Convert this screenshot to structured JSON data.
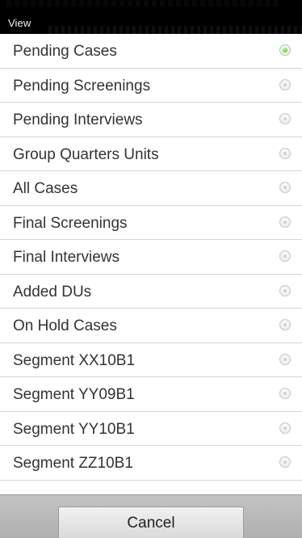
{
  "dialog": {
    "title": "View",
    "items": [
      {
        "label": "Pending Cases",
        "selected": true
      },
      {
        "label": "Pending Screenings",
        "selected": false
      },
      {
        "label": "Pending Interviews",
        "selected": false
      },
      {
        "label": "Group Quarters Units",
        "selected": false
      },
      {
        "label": "All Cases",
        "selected": false
      },
      {
        "label": "Final Screenings",
        "selected": false
      },
      {
        "label": "Final Interviews",
        "selected": false
      },
      {
        "label": "Added DUs",
        "selected": false
      },
      {
        "label": "On Hold Cases",
        "selected": false
      },
      {
        "label": "Segment XX10B1",
        "selected": false
      },
      {
        "label": "Segment YY09B1",
        "selected": false
      },
      {
        "label": "Segment YY10B1",
        "selected": false
      },
      {
        "label": "Segment ZZ10B1",
        "selected": false
      }
    ],
    "cancel_label": "Cancel"
  },
  "colors": {
    "header_bg": "#000000",
    "selected_radio": "#4fc72c",
    "footer_bg": "#b8b8b8"
  }
}
